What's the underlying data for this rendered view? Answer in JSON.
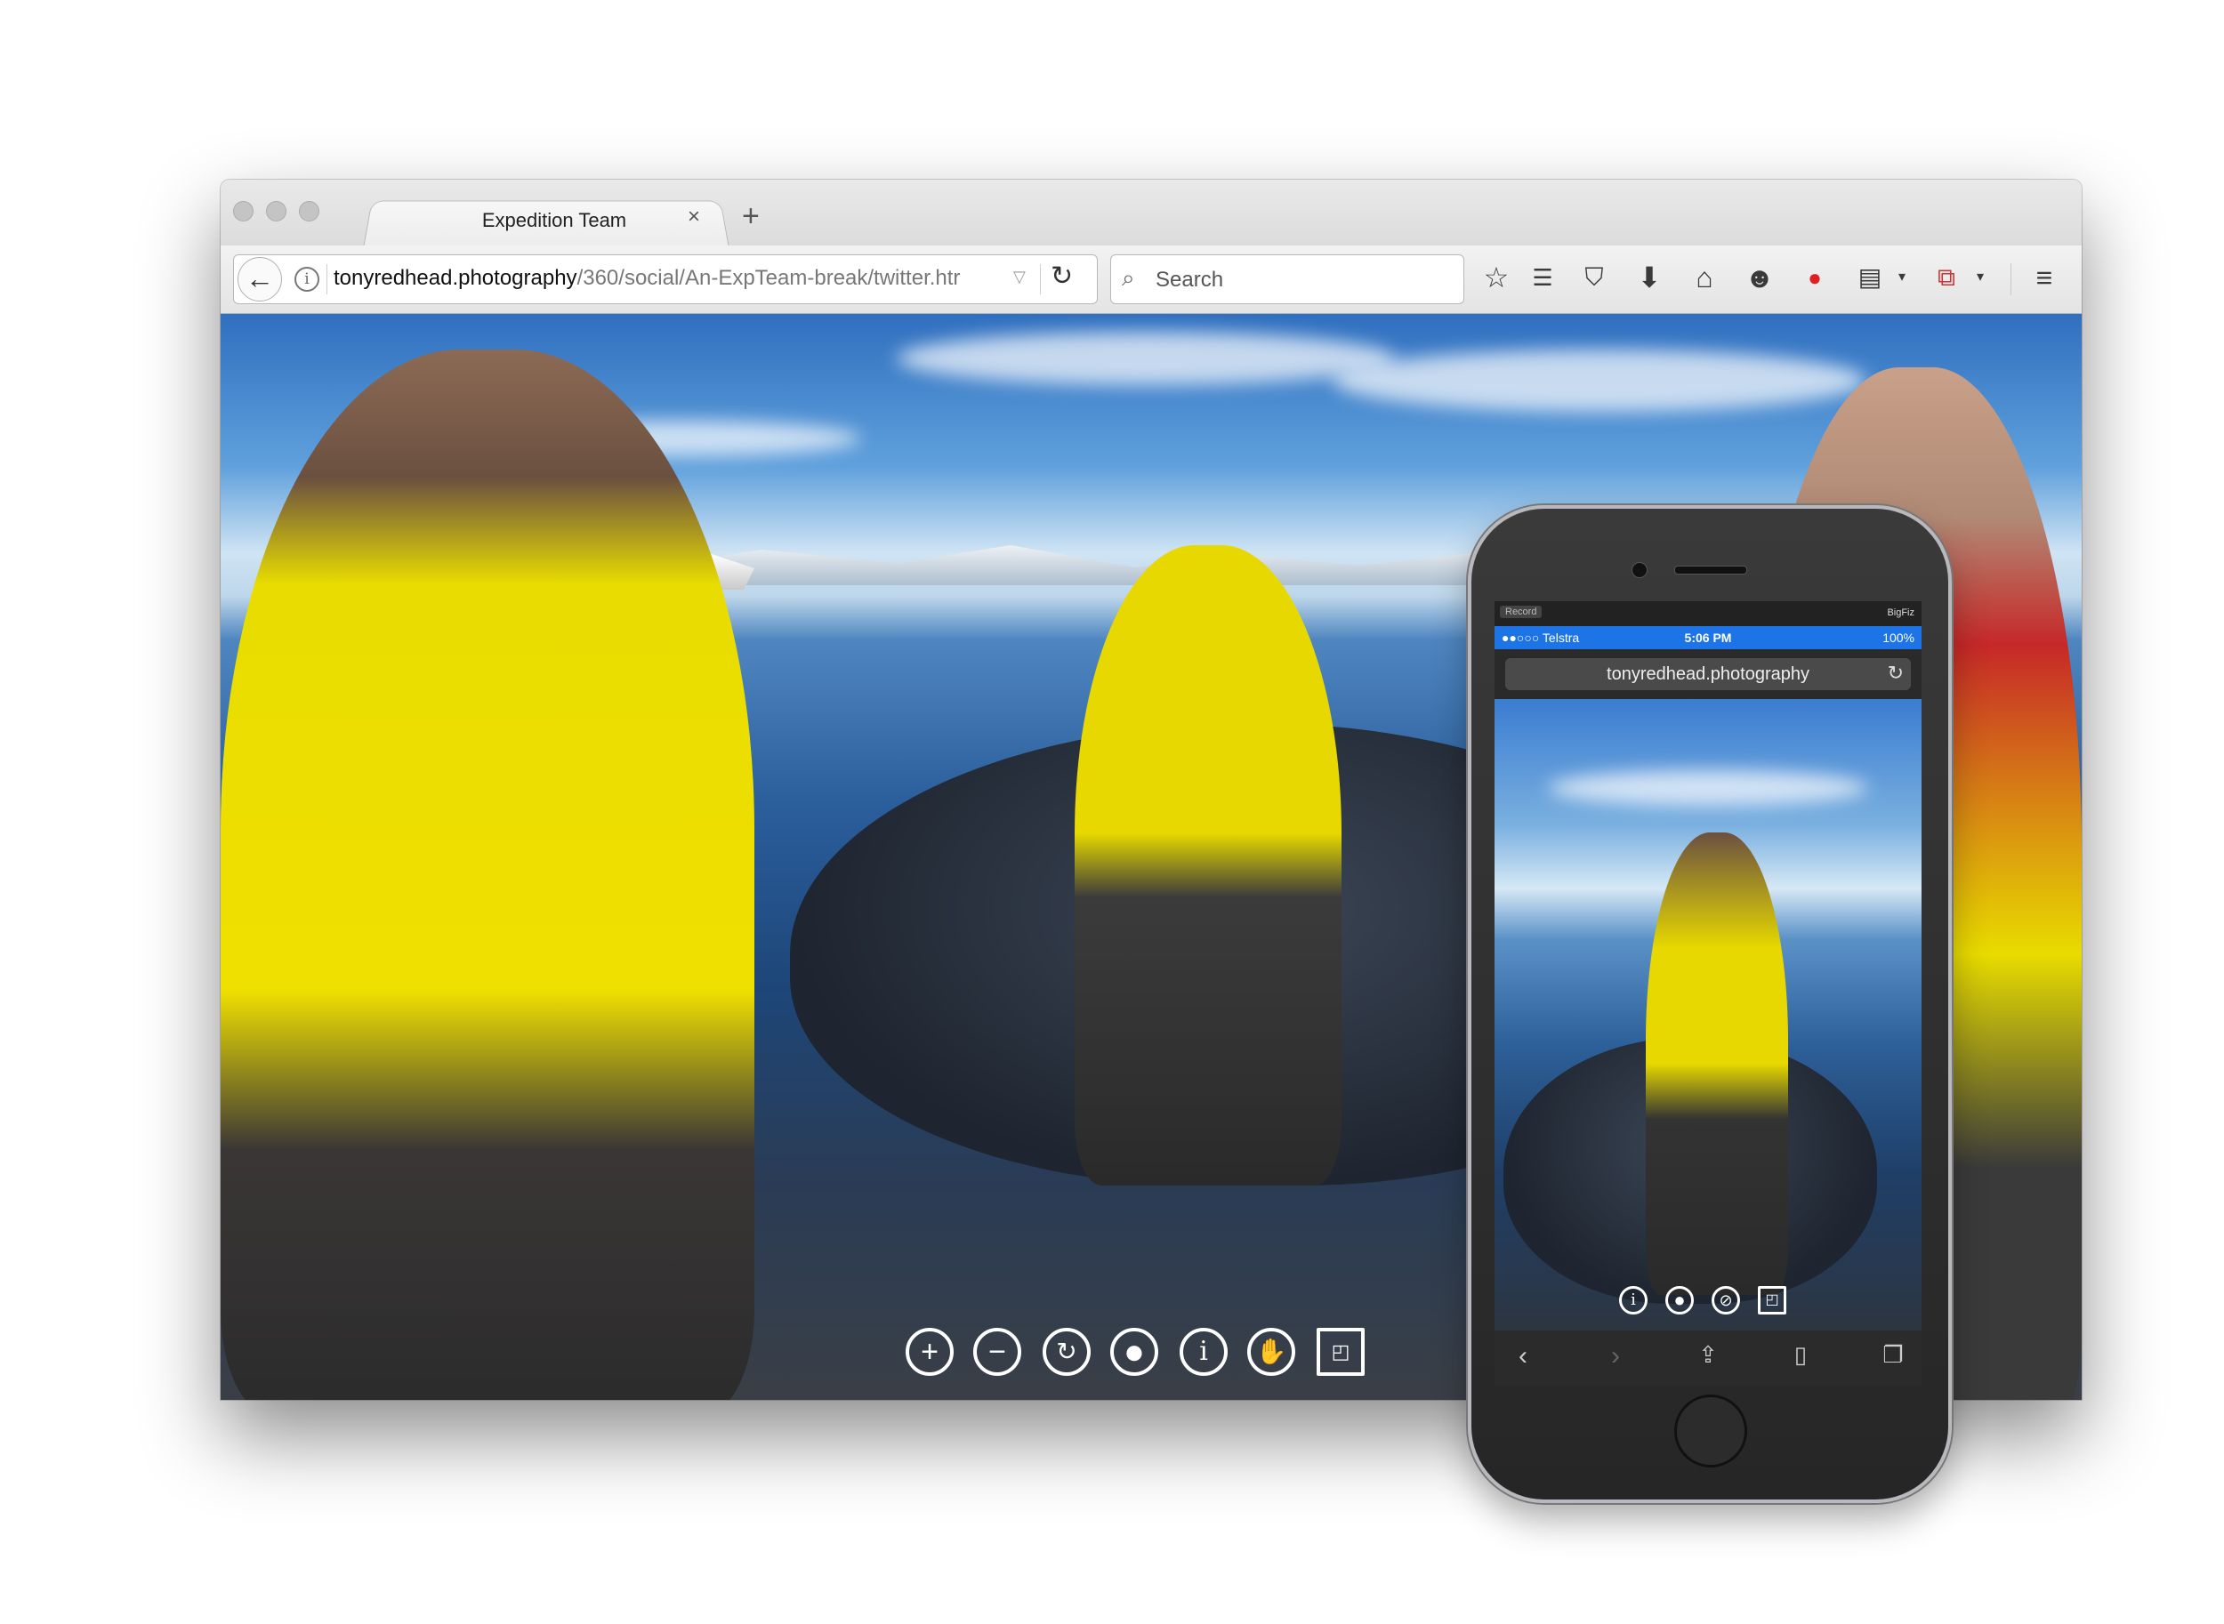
{
  "browser": {
    "tab_title": "Expedition Team",
    "tab_close": "×",
    "new_tab": "+",
    "url_domain": "tonyredhead.photography",
    "url_path": "/360/social/An-ExpTeam-break/twitter.htr",
    "search_placeholder": "Search",
    "icons": [
      "back-icon",
      "info-icon",
      "reload-icon",
      "search-icon",
      "bookmark-star-icon",
      "reading-list-icon",
      "pocket-icon",
      "download-icon",
      "home-icon",
      "chat-icon",
      "colors-icon",
      "clipboard-icon",
      "pdf-icon",
      "menu-icon"
    ]
  },
  "viewer": {
    "controls": [
      "zoom-in",
      "zoom-out",
      "autorotate",
      "record",
      "info",
      "drag",
      "fullscreen"
    ]
  },
  "phone": {
    "record_label": "Record",
    "app_label": "BigFiz",
    "carrier": "●●○○○ Telstra",
    "time": "5:06 PM",
    "battery": "100%",
    "url": "tonyredhead.photography",
    "viewer_controls": [
      "info",
      "record",
      "compass",
      "fullscreen"
    ],
    "toolbar": [
      "back",
      "forward",
      "share",
      "bookmarks",
      "tabs"
    ]
  }
}
